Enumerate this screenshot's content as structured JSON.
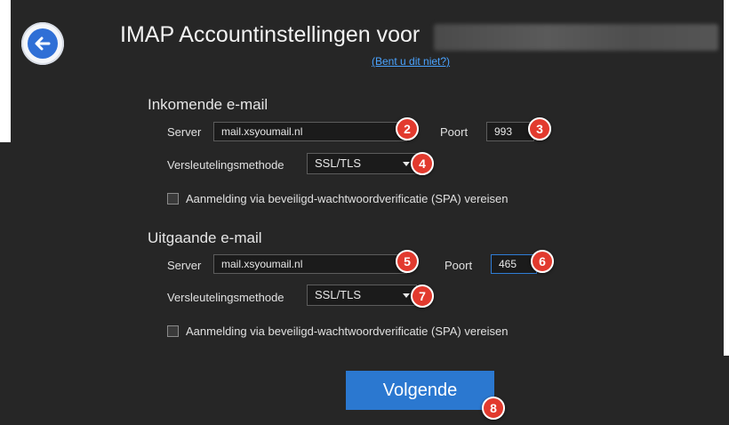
{
  "header": {
    "title": "IMAP Accountinstellingen voor",
    "not_you_link": "(Bent u dit niet?)"
  },
  "incoming": {
    "section_title": "Inkomende e-mail",
    "server_label": "Server",
    "server_value": "mail.xsyoumail.nl",
    "port_label": "Poort",
    "port_value": "993",
    "encryption_label": "Versleutelingsmethode",
    "encryption_value": "SSL/TLS",
    "spa_label": "Aanmelding via beveiligd-wachtwoordverificatie (SPA) vereisen"
  },
  "outgoing": {
    "section_title": "Uitgaande e-mail",
    "server_label": "Server",
    "server_value": "mail.xsyoumail.nl",
    "port_label": "Poort",
    "port_value": "465",
    "encryption_label": "Versleutelingsmethode",
    "encryption_value": "SSL/TLS",
    "spa_label": "Aanmelding via beveiligd-wachtwoordverificatie (SPA) vereisen"
  },
  "actions": {
    "next_label": "Volgende"
  },
  "badges": {
    "b2": "2",
    "b3": "3",
    "b4": "4",
    "b5": "5",
    "b6": "6",
    "b7": "7",
    "b8": "8"
  },
  "colors": {
    "accent": "#2b78d0",
    "badge": "#e23a2e",
    "background": "#262626"
  }
}
